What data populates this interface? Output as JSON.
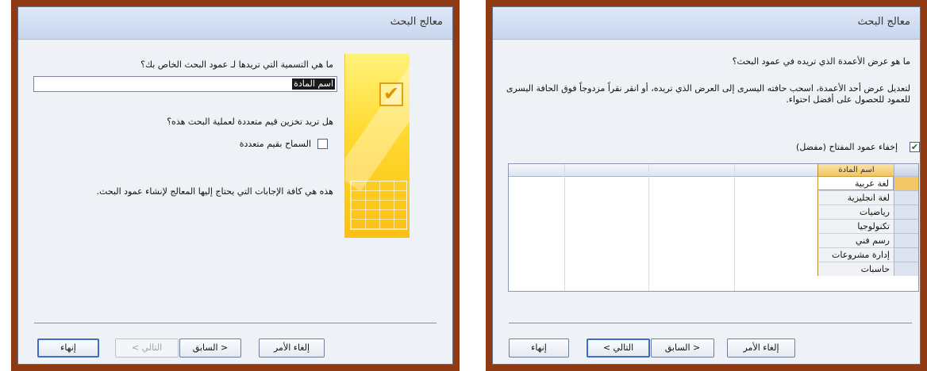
{
  "left_dialog": {
    "title": "معالج البحث",
    "question1": "ما هي التسمية التي تريدها لـ عمود البحث الخاص بك؟",
    "label_value": "اسم المادة",
    "question2": "هل تريد تخزين قيم متعددة لعملية البحث هذه؟",
    "allow_multiple_label": "السماح بقيم متعددة",
    "allow_multiple_checked": false,
    "info": "هذه هي كافة الإجابات التي يحتاج إليها المعالج لإنشاء عمود البحث.",
    "buttons": {
      "cancel": "إلغاء الأمر",
      "back": "< السابق",
      "next": "التالي >",
      "finish": "إنهاء"
    }
  },
  "right_dialog": {
    "title": "معالج البحث",
    "question": "ما هو عرض الأعمدة الذي تريده في عمود البحث؟",
    "instructions": "لتعديل عرض أحد الأعمدة، اسحب حافته اليسرى إلى العرض الذي تريده، أو انقر نقراً مزدوجاً فوق الحافة اليسرى للعمود للحصول على أفضل احتواء.",
    "hide_key_label": "إخفاء عمود المفتاح (مفضل)",
    "hide_key_checked": true,
    "grid": {
      "column_header": "اسم المادة",
      "rows": [
        "لغة عربية",
        "لغة انجليزية",
        "رياضيات",
        "تكنولوجيا",
        "رسم فني",
        "إدارة مشروعات",
        "حاسبات"
      ]
    },
    "buttons": {
      "cancel": "إلغاء الأمر",
      "back": "< السابق",
      "next": "التالي >",
      "finish": "إنهاء"
    }
  },
  "colors": {
    "frame": "#8f3a12",
    "dialog_bg": "#eef1f6",
    "titlebar": "#c7d6ee",
    "accent_yellow": "#ffd92e"
  }
}
